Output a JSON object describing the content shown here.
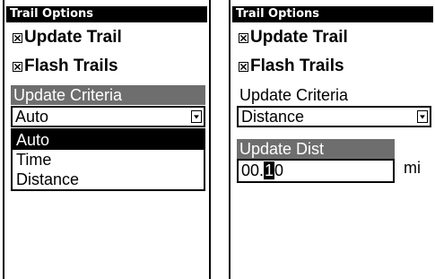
{
  "left_screen": {
    "title": "Trail Options",
    "update_trail": {
      "label": "Update Trail",
      "checked": true
    },
    "flash_trails": {
      "label": "Flash Trails",
      "checked": true
    },
    "criteria_label": "Update Criteria",
    "criteria_value": "Auto",
    "criteria_options": [
      "Auto",
      "Time",
      "Distance"
    ],
    "selected_option": "Auto"
  },
  "right_screen": {
    "title": "Trail Options",
    "update_trail": {
      "label": "Update Trail",
      "checked": true
    },
    "flash_trails": {
      "label": "Flash Trails",
      "checked": true
    },
    "criteria_label": "Update Criteria",
    "criteria_value": "Distance",
    "update_dist_label": "Update Dist",
    "dist_before_cursor": "00.",
    "dist_cursor_digit": "1",
    "dist_after_cursor": "0",
    "unit": "mi"
  },
  "colors": {
    "titlebar": "#000000",
    "highlight_label": "#6e6e6e",
    "selection": "#000000",
    "background": "#ffffff"
  },
  "icons": {
    "checkbox": "checkbox-checked-icon",
    "dropdown": "dropdown-arrow-icon"
  }
}
